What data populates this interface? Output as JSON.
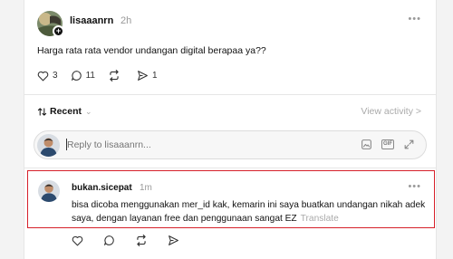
{
  "post": {
    "username": "lisaaanrn",
    "time": "2h",
    "text": "Harga rata rata vendor undangan digital berapaa ya??",
    "likes": "3",
    "replies": "11",
    "shares": "1"
  },
  "sort": {
    "label": "Recent",
    "view_activity": "View activity >"
  },
  "reply": {
    "placeholder": "Reply to lisaaanrn..."
  },
  "comment": {
    "username": "bukan.sicepat",
    "time": "1m",
    "text": "bisa dicoba menggunakan mer_id kak, kemarin ini saya buatkan undangan nikah adek saya, dengan layanan free dan penggunaan sangat EZ",
    "translate": "Translate"
  },
  "colors": {
    "highlight": "#d6202a"
  }
}
